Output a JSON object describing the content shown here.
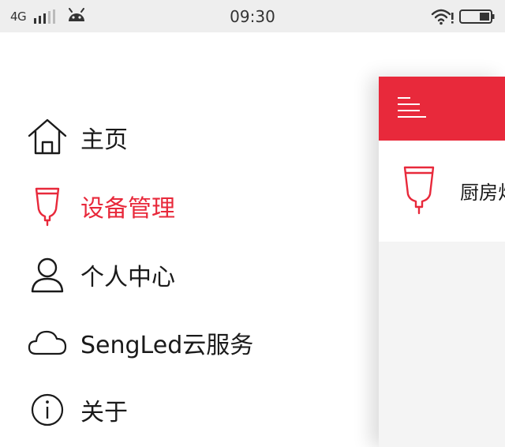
{
  "status_bar": {
    "network": "4G",
    "time": "09:30",
    "icons": [
      "signal-icon",
      "android-icon",
      "wifi-icon",
      "battery-icon"
    ]
  },
  "drawer": {
    "items": [
      {
        "label": "主页",
        "icon": "home-icon",
        "active": false
      },
      {
        "label": "设备管理",
        "icon": "bulb-icon",
        "active": true
      },
      {
        "label": "个人中心",
        "icon": "user-icon",
        "active": false
      },
      {
        "label": "SengLed云服务",
        "icon": "cloud-icon",
        "active": false
      },
      {
        "label": "关于",
        "icon": "info-icon",
        "active": false
      }
    ]
  },
  "panel": {
    "header_icon": "menu-icon",
    "devices": [
      {
        "name": "厨房灯",
        "icon": "bulb-icon"
      }
    ]
  },
  "colors": {
    "accent": "#e8293b",
    "status_bar_bg": "#eeeeee",
    "text": "#1a1a1a",
    "panel_bg": "#f4f4f4"
  }
}
